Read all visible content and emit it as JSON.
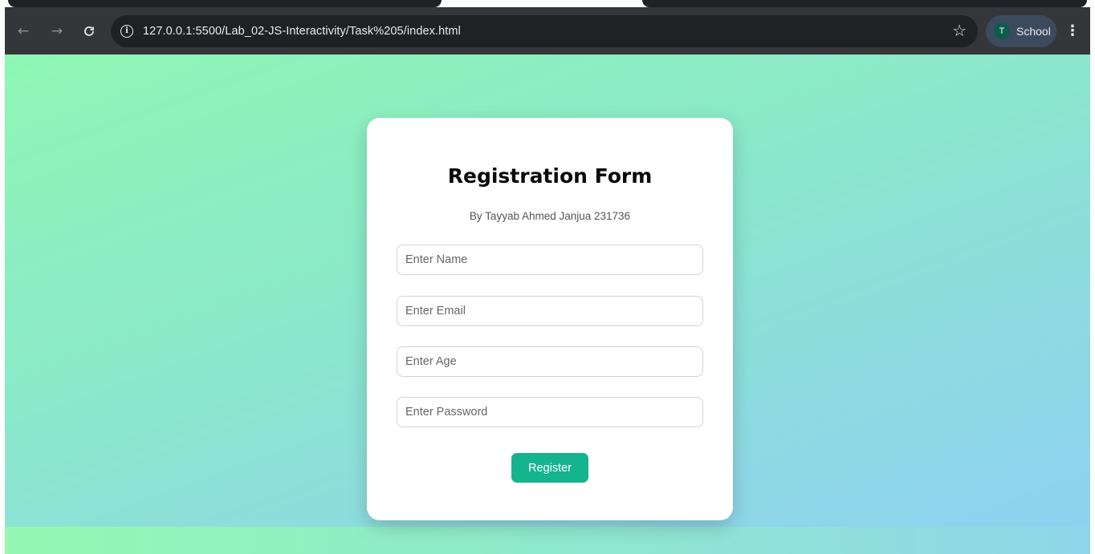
{
  "browser": {
    "url": "127.0.0.1:5500/Lab_02-JS-Interactivity/Task%205/index.html",
    "profile_initial": "T",
    "profile_name": "School",
    "icons": {
      "back": "arrow-left-icon",
      "forward": "arrow-right-icon",
      "reload": "reload-icon",
      "site_info": "info-icon",
      "bookmark": "star-icon",
      "menu": "kebab-menu-icon"
    }
  },
  "form": {
    "title": "Registration Form",
    "subtitle": "By Tayyab Ahmed Janjua 231736",
    "fields": [
      {
        "placeholder": "Enter Name",
        "value": ""
      },
      {
        "placeholder": "Enter Email",
        "value": ""
      },
      {
        "placeholder": "Enter Age",
        "value": ""
      },
      {
        "placeholder": "Enter Password",
        "value": ""
      }
    ],
    "submit_label": "Register"
  },
  "colors": {
    "button": "#14b48f",
    "gradient_start": "#8ef7b4",
    "gradient_end": "#8fd0f2"
  }
}
